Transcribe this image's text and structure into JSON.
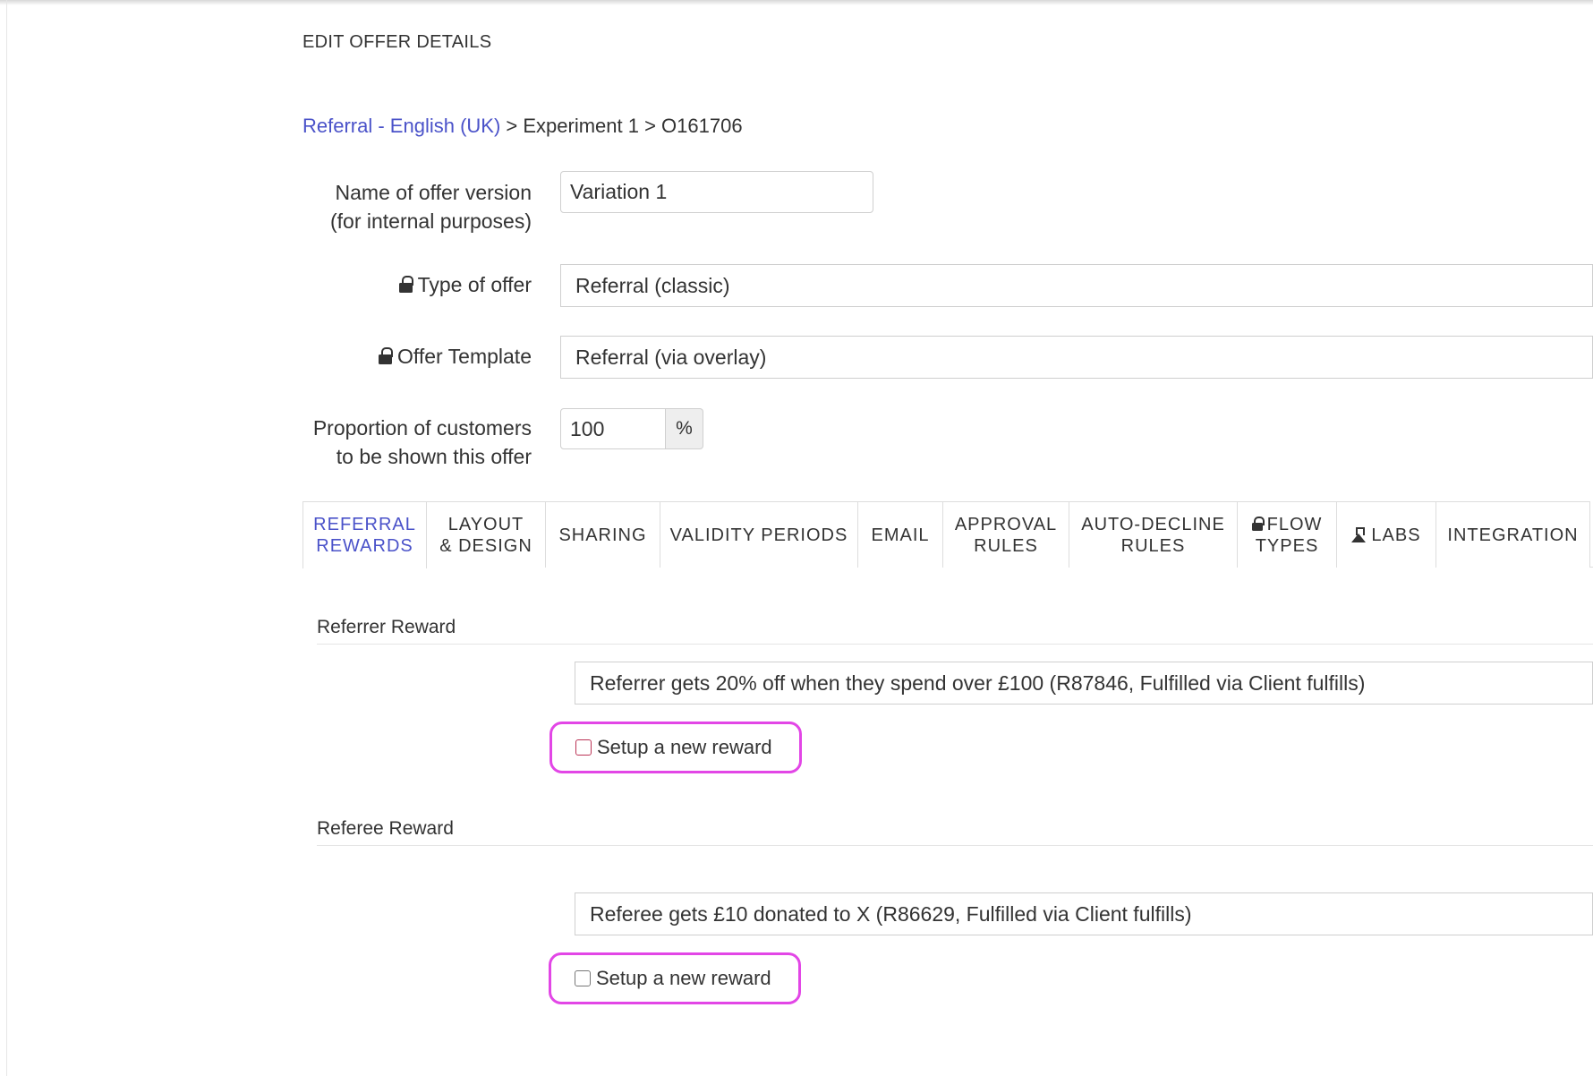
{
  "page": {
    "heading": "EDIT OFFER DETAILS"
  },
  "breadcrumb": {
    "link": "Referral - English (UK)",
    "rest": " > Experiment 1 > O161706"
  },
  "form": {
    "name_label_line1": "Name of offer version",
    "name_label_line2": "(for internal purposes)",
    "name_value": "Variation 1",
    "type_label": "Type of offer",
    "type_value": "Referral (classic)",
    "template_label": "Offer Template",
    "template_value": "Referral (via overlay)",
    "proportion_label_line1": "Proportion of customers",
    "proportion_label_line2": "to be shown this offer",
    "proportion_value": "100",
    "proportion_unit": "%"
  },
  "tabs": [
    {
      "line1": "REFERRAL",
      "line2": "REWARDS",
      "active": true
    },
    {
      "line1": "LAYOUT",
      "line2": "& DESIGN"
    },
    {
      "line1": "SHARING"
    },
    {
      "line1": "VALIDITY PERIODS"
    },
    {
      "line1": "EMAIL"
    },
    {
      "line1": "APPROVAL",
      "line2": "RULES"
    },
    {
      "line1": "AUTO-DECLINE",
      "line2": "RULES"
    },
    {
      "line1": "FLOW",
      "line2": "TYPES",
      "icon": "lock-icon"
    },
    {
      "line1": "LABS",
      "icon": "flask-icon"
    },
    {
      "line1": "INTEGRATION"
    }
  ],
  "referrer": {
    "title": "Referrer Reward",
    "selected": "Referrer gets 20% off when they spend over £100 (R87846, Fulfilled via Client fulfills)",
    "new_reward_label": "Setup a new reward"
  },
  "referee": {
    "title": "Referee Reward",
    "selected": "Referee gets £10 donated to X (R86629, Fulfilled via Client fulfills)",
    "new_reward_label": "Setup a new reward"
  },
  "colors": {
    "link": "#4a52c9",
    "highlight": "#e246e6"
  }
}
